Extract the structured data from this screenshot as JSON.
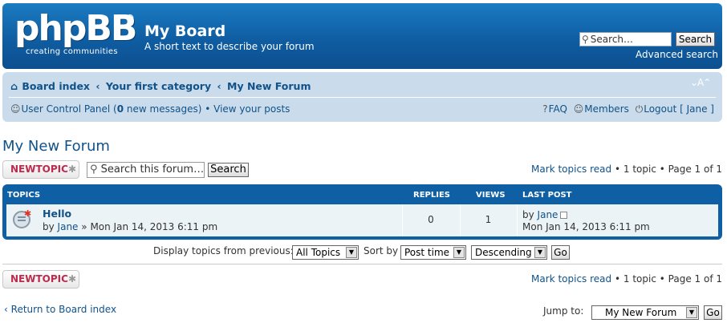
{
  "header": {
    "logo_text": "phpBB",
    "logo_reg": "®",
    "logo_tagline": "creating   communities",
    "site_title": "My Board",
    "site_description": "A short text to describe your forum",
    "search_placeholder": "Search…",
    "search_button": "Search",
    "advanced_search": "Advanced search"
  },
  "breadcrumbs": {
    "items": [
      "Board index",
      "Your first category",
      "My New Forum"
    ],
    "separator": "‹",
    "font_size_toggle": "⌄A⌃"
  },
  "user_nav": {
    "ucp_label": "User Control Panel (",
    "new_messages_count": "0",
    "new_messages_label": " new messages)",
    "bullet": "•",
    "view_posts": "View your posts",
    "faq": "FAQ",
    "members": "Members",
    "logout": "Logout [ Jane ]"
  },
  "forum": {
    "title": "My New Forum",
    "new_topic_label": "NEWTOPIC",
    "search_forum_placeholder": "Search this forum…",
    "search_button": "Search",
    "pagination": {
      "mark_read": "Mark topics read",
      "topic_count": "1 topic",
      "page_info": "Page 1 of 1",
      "bullet": "•"
    }
  },
  "topics_table": {
    "headers": {
      "topics": "Topics",
      "replies": "Replies",
      "views": "Views",
      "last_post": "Last post"
    },
    "rows": [
      {
        "title": "Hello",
        "by_prefix": "by",
        "author": "Jane",
        "date_sep": "»",
        "date": "Mon Jan 14, 2013 6:11 pm",
        "replies": "0",
        "views": "1",
        "last_post_by": "by",
        "last_post_author": "Jane",
        "last_post_date": "Mon Jan 14, 2013 6:11 pm"
      }
    ]
  },
  "display_options": {
    "from_label": "Display topics from previous:",
    "from_value": "All Topics",
    "sort_label": "Sort by",
    "sort_value": "Post time",
    "order_value": "Descending",
    "go_button": "Go"
  },
  "footer_nav": {
    "return_label": "Return to Board index",
    "jump_label": "Jump to:",
    "jump_value": "My New Forum",
    "go_button": "Go"
  },
  "colors": {
    "header_blue": "#0f5da2",
    "navbar_bg": "#cadceb",
    "link": "#105289",
    "new_topic_red": "#bc2a4d",
    "row_bg": "#ecf3f7"
  }
}
